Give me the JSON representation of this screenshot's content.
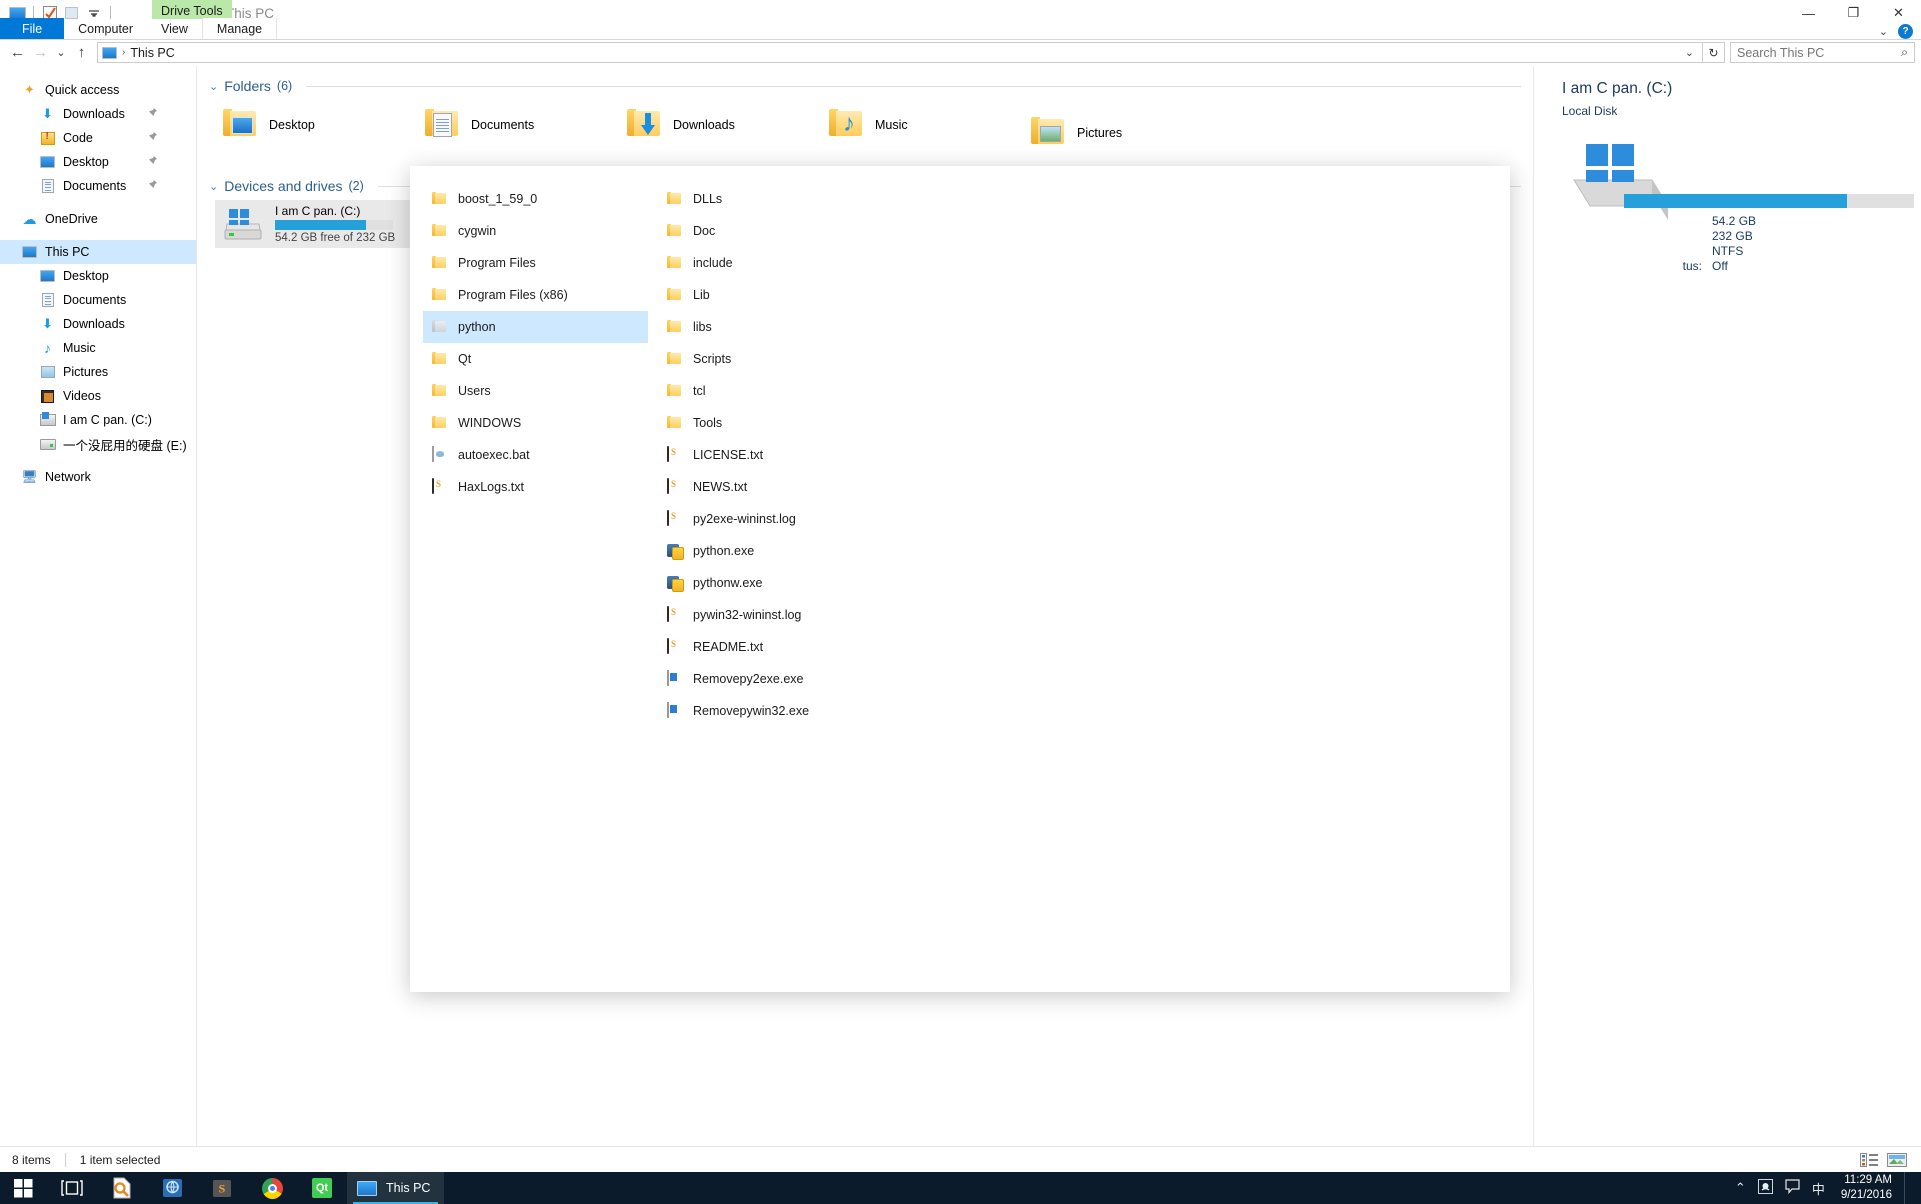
{
  "window": {
    "title": "This PC",
    "contextual_tab": "Drive Tools",
    "minimize": "—",
    "maximize": "❐",
    "close": "✕",
    "qat_icons": [
      "this-pc-icon",
      "properties-icon",
      "open-icon",
      "customize-dropdown-icon"
    ],
    "ribbon_collapse": "⌄",
    "help": "?"
  },
  "ribbon": {
    "tabs": [
      {
        "label": "File",
        "kind": "file"
      },
      {
        "label": "Computer",
        "kind": "normal"
      },
      {
        "label": "View",
        "kind": "normal"
      },
      {
        "label": "Manage",
        "kind": "manage"
      }
    ]
  },
  "addressbar": {
    "back": "←",
    "forward": "→",
    "recent": "⌄",
    "up": "↑",
    "path_icon": "this-pc-icon",
    "path": "This PC",
    "separator": "›",
    "dropdown": "⌄",
    "refresh": "↻",
    "search_placeholder": "Search This PC",
    "search_value": "",
    "search_icon": "⌕"
  },
  "navpane": {
    "sections": [
      {
        "name": "Quick access",
        "icon": "star-icon",
        "items": [
          {
            "label": "Downloads",
            "icon": "download-icon",
            "pinned": true
          },
          {
            "label": "Code",
            "icon": "code-folder-icon",
            "pinned": true
          },
          {
            "label": "Desktop",
            "icon": "monitor-icon",
            "pinned": true
          },
          {
            "label": "Documents",
            "icon": "document-icon",
            "pinned": true
          }
        ]
      },
      {
        "name": "OneDrive",
        "icon": "cloud-icon",
        "items": []
      },
      {
        "name": "This PC",
        "icon": "this-pc-icon",
        "selected": true,
        "items": [
          {
            "label": "Desktop",
            "icon": "monitor-icon"
          },
          {
            "label": "Documents",
            "icon": "document-icon"
          },
          {
            "label": "Downloads",
            "icon": "download-icon"
          },
          {
            "label": "Music",
            "icon": "music-note-icon"
          },
          {
            "label": "Pictures",
            "icon": "picture-icon"
          },
          {
            "label": "Videos",
            "icon": "video-icon"
          },
          {
            "label": "I am C pan. (C:)",
            "icon": "windows-drive-icon"
          },
          {
            "label": "一个没屁用的硬盘 (E:)",
            "icon": "drive-icon"
          }
        ]
      },
      {
        "name": "Network",
        "icon": "network-icon",
        "items": []
      }
    ],
    "pin_glyph": "📌"
  },
  "content": {
    "groups": [
      {
        "chevron": "⌄",
        "title": "Folders",
        "count": "(6)",
        "tiles": [
          {
            "label": "Desktop",
            "icon": "folder-desktop-icon"
          },
          {
            "label": "Documents",
            "icon": "folder-documents-icon"
          },
          {
            "label": "Downloads",
            "icon": "folder-downloads-icon"
          },
          {
            "label": "Music",
            "icon": "folder-music-icon"
          },
          {
            "label": "Pictures",
            "icon": "folder-pictures-icon"
          }
        ]
      },
      {
        "chevron": "⌄",
        "title": "Devices and drives",
        "count": "(2)",
        "drives": [
          {
            "name": "I am C pan. (C:)",
            "free_text": "54.2 GB free of 232 GB",
            "used_percent": 77,
            "selected": true,
            "icon": "windows-drive-icon"
          }
        ]
      }
    ]
  },
  "details": {
    "title": "I am C pan. (C:)",
    "subtitle": "Local Disk",
    "icon": "drive-large-icon",
    "used_percent": 77,
    "rows": [
      {
        "key": "",
        "value": "54.2 GB"
      },
      {
        "key": "",
        "value": "232 GB"
      },
      {
        "key": "",
        "value": "NTFS"
      },
      {
        "key": "tus:",
        "value": "Off"
      }
    ]
  },
  "overlay": {
    "columns": [
      {
        "items": [
          {
            "label": "boost_1_59_0",
            "icon": "folder-icon",
            "type": "folder"
          },
          {
            "label": "cygwin",
            "icon": "folder-icon",
            "type": "folder"
          },
          {
            "label": "Program Files",
            "icon": "folder-icon",
            "type": "folder"
          },
          {
            "label": "Program Files (x86)",
            "icon": "folder-icon",
            "type": "folder"
          },
          {
            "label": "python",
            "icon": "folder-gray-icon",
            "type": "folder-gray",
            "selected": true
          },
          {
            "label": "Qt",
            "icon": "folder-icon",
            "type": "folder"
          },
          {
            "label": "Users",
            "icon": "folder-icon",
            "type": "folder"
          },
          {
            "label": "WINDOWS",
            "icon": "folder-icon",
            "type": "folder"
          },
          {
            "label": "autoexec.bat",
            "icon": "bat-file-icon",
            "type": "bat"
          },
          {
            "label": "HaxLogs.txt",
            "icon": "text-file-icon",
            "type": "txt"
          }
        ]
      },
      {
        "items": [
          {
            "label": "DLLs",
            "icon": "folder-icon",
            "type": "folder"
          },
          {
            "label": "Doc",
            "icon": "folder-icon",
            "type": "folder"
          },
          {
            "label": "include",
            "icon": "folder-icon",
            "type": "folder"
          },
          {
            "label": "Lib",
            "icon": "folder-icon",
            "type": "folder"
          },
          {
            "label": "libs",
            "icon": "folder-icon",
            "type": "folder"
          },
          {
            "label": "Scripts",
            "icon": "folder-icon",
            "type": "folder"
          },
          {
            "label": "tcl",
            "icon": "folder-icon",
            "type": "folder"
          },
          {
            "label": "Tools",
            "icon": "folder-icon",
            "type": "folder"
          },
          {
            "label": "LICENSE.txt",
            "icon": "text-file-icon",
            "type": "txt"
          },
          {
            "label": "NEWS.txt",
            "icon": "text-file-icon",
            "type": "txt"
          },
          {
            "label": "py2exe-wininst.log",
            "icon": "text-file-icon",
            "type": "txt"
          },
          {
            "label": "python.exe",
            "icon": "python-exe-icon",
            "type": "pyexe"
          },
          {
            "label": "pythonw.exe",
            "icon": "python-exe-icon",
            "type": "pyexe"
          },
          {
            "label": "pywin32-wininst.log",
            "icon": "text-file-icon",
            "type": "txt"
          },
          {
            "label": "README.txt",
            "icon": "text-file-icon",
            "type": "txt"
          },
          {
            "label": "Removepy2exe.exe",
            "icon": "windows-exe-icon",
            "type": "winexe"
          },
          {
            "label": "Removepywin32.exe",
            "icon": "windows-exe-icon",
            "type": "winexe"
          }
        ]
      }
    ]
  },
  "statusbar": {
    "item_count": "8 items",
    "selection": "1 item selected",
    "view_details_icon": "details-view-icon",
    "view_tiles_icon": "large-icons-view-icon"
  },
  "taskbar": {
    "start": "start-icon",
    "taskview": "task-view-icon",
    "pinned": [
      {
        "name": "search-document-icon"
      },
      {
        "name": "dictionary-icon"
      },
      {
        "name": "sublime-text-icon"
      },
      {
        "name": "chrome-icon"
      },
      {
        "name": "qt-creator-icon"
      }
    ],
    "active_task": {
      "label": "This PC",
      "icon": "this-pc-icon"
    },
    "tray": {
      "overflow": "⌃",
      "icons": [
        "onedrive-icon",
        "action-center-icon"
      ],
      "ime": "中",
      "time": "11:29 AM",
      "date": "9/21/2016"
    }
  },
  "colors": {
    "accent": "#0078d7",
    "selection": "#cde8ff",
    "drive_bar": "#26a0da",
    "contextual_tab": "#b9e8a8",
    "taskbar": "#0b1b2b"
  }
}
